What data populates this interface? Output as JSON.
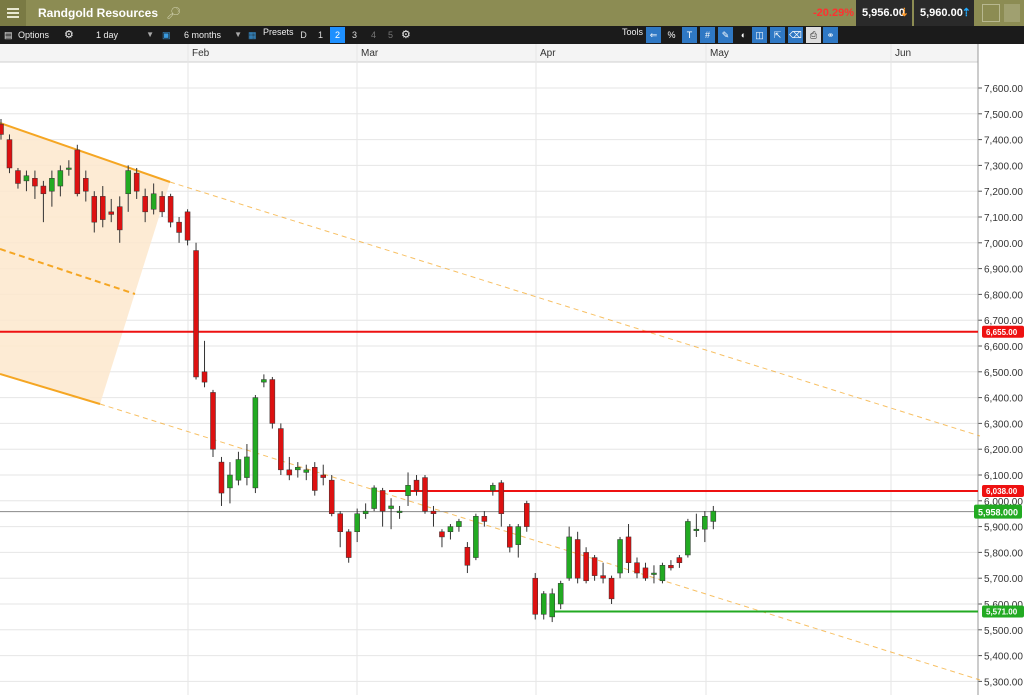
{
  "titlebar": {
    "menu_icon": "hamburger-icon",
    "instrument": "Randgold Resources",
    "search_icon": "search-icon",
    "change": "-20.29%",
    "sell_price": "5,956.00",
    "buy_price": "5,960.00",
    "colors": {
      "bar": "#8c8c53",
      "change": "#ff3030",
      "sell_arrow": "#ff9a2a",
      "buy_arrow": "#22aaff"
    }
  },
  "toolbar": {
    "options_label": "Options",
    "interval": "1 day",
    "range": "6 months",
    "presets_label": "Presets",
    "d_label": "D",
    "presets": [
      "1",
      "2",
      "3",
      "4",
      "5"
    ],
    "active_preset": "2",
    "tools_label": "Tools",
    "tool_icons": [
      "arrow-left-icon",
      "percent-icon",
      "text-icon",
      "crosshair-icon",
      "brush-icon",
      "drop-icon",
      "layers-icon",
      "resize-icon",
      "eraser-icon",
      "print-icon",
      "share-icon"
    ],
    "percent_glyph": "%",
    "text_glyph": "T"
  },
  "chart_data": {
    "type": "candlestick",
    "x_labels": [
      "Feb",
      "Mar",
      "Apr",
      "May",
      "Jun"
    ],
    "y_ticks": [
      "7,600.00",
      "7,500.00",
      "7,400.00",
      "7,300.00",
      "7,200.00",
      "7,100.00",
      "7,000.00",
      "6,900.00",
      "6,800.00",
      "6,700.00",
      "6,600.00",
      "6,500.00",
      "6,400.00",
      "6,300.00",
      "6,200.00",
      "6,100.00",
      "6,000.00",
      "5,900.00",
      "5,800.00",
      "5,700.00",
      "5,600.00",
      "5,500.00",
      "5,400.00",
      "5,300.00"
    ],
    "ylim": [
      5290,
      7650
    ],
    "grid": true,
    "horizontal_lines": [
      {
        "value": 6655,
        "label": "6,655.00",
        "color": "#ee1111"
      },
      {
        "value": 6038,
        "label": "6,038.00",
        "color": "#ee1111"
      },
      {
        "value": 5571,
        "label": "5,571.00",
        "color": "#22aa22"
      }
    ],
    "current_price": {
      "value": 5958,
      "label": "5,958.000",
      "color": "#22aa22"
    },
    "candles": [
      {
        "o": 7460,
        "c": 7420,
        "h": 7480,
        "l": 7400
      },
      {
        "o": 7400,
        "c": 7290,
        "h": 7420,
        "l": 7270
      },
      {
        "o": 7280,
        "c": 7230,
        "h": 7290,
        "l": 7210
      },
      {
        "o": 7240,
        "c": 7260,
        "h": 7280,
        "l": 7200
      },
      {
        "o": 7250,
        "c": 7220,
        "h": 7280,
        "l": 7170
      },
      {
        "o": 7220,
        "c": 7190,
        "h": 7240,
        "l": 7080
      },
      {
        "o": 7200,
        "c": 7250,
        "h": 7280,
        "l": 7140
      },
      {
        "o": 7220,
        "c": 7280,
        "h": 7300,
        "l": 7180
      },
      {
        "o": 7290,
        "c": 7290,
        "h": 7320,
        "l": 7260
      },
      {
        "o": 7360,
        "c": 7190,
        "h": 7380,
        "l": 7180
      },
      {
        "o": 7250,
        "c": 7200,
        "h": 7280,
        "l": 7160
      },
      {
        "o": 7180,
        "c": 7080,
        "h": 7200,
        "l": 7040
      },
      {
        "o": 7180,
        "c": 7090,
        "h": 7220,
        "l": 7060
      },
      {
        "o": 7120,
        "c": 7110,
        "h": 7170,
        "l": 7080
      },
      {
        "o": 7140,
        "c": 7050,
        "h": 7180,
        "l": 7000
      },
      {
        "o": 7190,
        "c": 7280,
        "h": 7300,
        "l": 7120
      },
      {
        "o": 7270,
        "c": 7200,
        "h": 7290,
        "l": 7170
      },
      {
        "o": 7180,
        "c": 7120,
        "h": 7210,
        "l": 7080
      },
      {
        "o": 7130,
        "c": 7190,
        "h": 7230,
        "l": 7110
      },
      {
        "o": 7180,
        "c": 7120,
        "h": 7200,
        "l": 7100
      },
      {
        "o": 7180,
        "c": 7080,
        "h": 7190,
        "l": 7060
      },
      {
        "o": 7080,
        "c": 7040,
        "h": 7100,
        "l": 7000
      },
      {
        "o": 7120,
        "c": 7010,
        "h": 7130,
        "l": 6990
      },
      {
        "o": 6970,
        "c": 6480,
        "h": 7000,
        "l": 6470
      },
      {
        "o": 6500,
        "c": 6460,
        "h": 6620,
        "l": 6440
      },
      {
        "o": 6420,
        "c": 6200,
        "h": 6430,
        "l": 6170
      },
      {
        "o": 6150,
        "c": 6030,
        "h": 6170,
        "l": 5980
      },
      {
        "o": 6050,
        "c": 6100,
        "h": 6150,
        "l": 5990
      },
      {
        "o": 6080,
        "c": 6160,
        "h": 6190,
        "l": 6060
      },
      {
        "o": 6090,
        "c": 6170,
        "h": 6220,
        "l": 6060
      },
      {
        "o": 6050,
        "c": 6400,
        "h": 6410,
        "l": 6030
      },
      {
        "o": 6460,
        "c": 6470,
        "h": 6490,
        "l": 6440
      },
      {
        "o": 6470,
        "c": 6300,
        "h": 6480,
        "l": 6280
      },
      {
        "o": 6280,
        "c": 6120,
        "h": 6300,
        "l": 6100
      },
      {
        "o": 6120,
        "c": 6100,
        "h": 6170,
        "l": 6080
      },
      {
        "o": 6120,
        "c": 6130,
        "h": 6150,
        "l": 6090
      },
      {
        "o": 6110,
        "c": 6120,
        "h": 6140,
        "l": 6080
      },
      {
        "o": 6130,
        "c": 6040,
        "h": 6150,
        "l": 6020
      },
      {
        "o": 6100,
        "c": 6090,
        "h": 6140,
        "l": 6060
      },
      {
        "o": 6080,
        "c": 5950,
        "h": 6100,
        "l": 5940
      },
      {
        "o": 5950,
        "c": 5880,
        "h": 5960,
        "l": 5820
      },
      {
        "o": 5880,
        "c": 5780,
        "h": 5890,
        "l": 5760
      },
      {
        "o": 5880,
        "c": 5950,
        "h": 5970,
        "l": 5840
      },
      {
        "o": 5950,
        "c": 5960,
        "h": 5990,
        "l": 5930
      },
      {
        "o": 5970,
        "c": 6050,
        "h": 6060,
        "l": 5960
      },
      {
        "o": 6040,
        "c": 5960,
        "h": 6050,
        "l": 5900
      },
      {
        "o": 5970,
        "c": 5980,
        "h": 6010,
        "l": 5890
      },
      {
        "o": 5960,
        "c": 5960,
        "h": 5980,
        "l": 5930
      },
      {
        "o": 6020,
        "c": 6060,
        "h": 6110,
        "l": 5980
      },
      {
        "o": 6080,
        "c": 6040,
        "h": 6100,
        "l": 6020
      },
      {
        "o": 6090,
        "c": 5960,
        "h": 6100,
        "l": 5950
      },
      {
        "o": 5960,
        "c": 5950,
        "h": 5980,
        "l": 5900
      },
      {
        "o": 5880,
        "c": 5860,
        "h": 5890,
        "l": 5820
      },
      {
        "o": 5880,
        "c": 5900,
        "h": 5910,
        "l": 5850
      },
      {
        "o": 5900,
        "c": 5920,
        "h": 5930,
        "l": 5880
      },
      {
        "o": 5820,
        "c": 5750,
        "h": 5840,
        "l": 5720
      },
      {
        "o": 5780,
        "c": 5940,
        "h": 5950,
        "l": 5770
      },
      {
        "o": 5940,
        "c": 5920,
        "h": 5960,
        "l": 5900
      },
      {
        "o": 6040,
        "c": 6060,
        "h": 6070,
        "l": 6020
      },
      {
        "o": 6070,
        "c": 5950,
        "h": 6080,
        "l": 5900
      },
      {
        "o": 5900,
        "c": 5820,
        "h": 5910,
        "l": 5800
      },
      {
        "o": 5830,
        "c": 5900,
        "h": 5910,
        "l": 5780
      },
      {
        "o": 5990,
        "c": 5900,
        "h": 6000,
        "l": 5880
      },
      {
        "o": 5700,
        "c": 5560,
        "h": 5720,
        "l": 5540
      },
      {
        "o": 5560,
        "c": 5640,
        "h": 5650,
        "l": 5540
      },
      {
        "o": 5550,
        "c": 5640,
        "h": 5660,
        "l": 5530
      },
      {
        "o": 5600,
        "c": 5680,
        "h": 5690,
        "l": 5580
      },
      {
        "o": 5700,
        "c": 5860,
        "h": 5900,
        "l": 5690
      },
      {
        "o": 5850,
        "c": 5700,
        "h": 5880,
        "l": 5680
      },
      {
        "o": 5800,
        "c": 5690,
        "h": 5820,
        "l": 5680
      },
      {
        "o": 5780,
        "c": 5710,
        "h": 5790,
        "l": 5690
      },
      {
        "o": 5710,
        "c": 5700,
        "h": 5760,
        "l": 5680
      },
      {
        "o": 5700,
        "c": 5620,
        "h": 5710,
        "l": 5600
      },
      {
        "o": 5720,
        "c": 5850,
        "h": 5860,
        "l": 5700
      },
      {
        "o": 5860,
        "c": 5760,
        "h": 5910,
        "l": 5720
      },
      {
        "o": 5760,
        "c": 5720,
        "h": 5780,
        "l": 5700
      },
      {
        "o": 5740,
        "c": 5700,
        "h": 5760,
        "l": 5690
      },
      {
        "o": 5720,
        "c": 5720,
        "h": 5750,
        "l": 5680
      },
      {
        "o": 5690,
        "c": 5750,
        "h": 5760,
        "l": 5680
      },
      {
        "o": 5750,
        "c": 5740,
        "h": 5770,
        "l": 5730
      },
      {
        "o": 5780,
        "c": 5760,
        "h": 5790,
        "l": 5740
      },
      {
        "o": 5790,
        "c": 5920,
        "h": 5930,
        "l": 5780
      },
      {
        "o": 5890,
        "c": 5890,
        "h": 5950,
        "l": 5860
      },
      {
        "o": 5890,
        "c": 5940,
        "h": 5960,
        "l": 5840
      },
      {
        "o": 5920,
        "c": 5960,
        "h": 5980,
        "l": 5890
      }
    ],
    "colors": {
      "up": "#22aa22",
      "down": "#dd1111",
      "channel": "#f5a623",
      "channel_fill": "#fde8cc",
      "grid": "#e6e6e6"
    }
  }
}
